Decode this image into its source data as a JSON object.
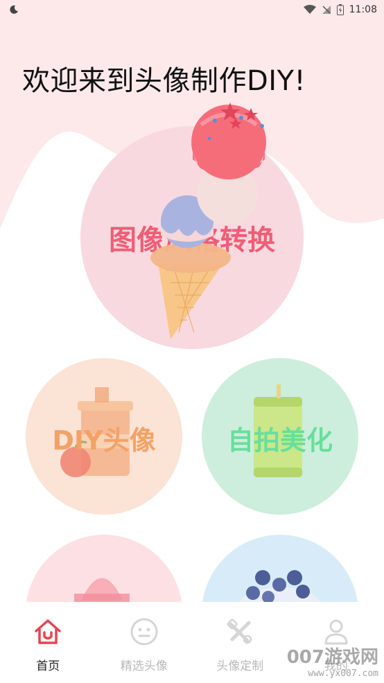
{
  "status_bar": {
    "time": "11:08"
  },
  "welcome": "欢迎来到头像制作DIY!",
  "cards": {
    "style_transfer": "图像风格转换",
    "diy_avatar": "DIY头像",
    "selfie_beauty": "自拍美化"
  },
  "tabs": [
    {
      "label": "首页",
      "icon": "home-icon",
      "active": true
    },
    {
      "label": "精选头像",
      "icon": "smiley-icon",
      "active": false
    },
    {
      "label": "头像定制",
      "icon": "tools-icon",
      "active": false
    },
    {
      "label": "我的",
      "icon": "person-icon",
      "active": false
    }
  ],
  "watermark": {
    "title": "007游戏网",
    "url": "www.yx007.com"
  },
  "colors": {
    "accent": "#e8444e",
    "style_text": "#f0506a",
    "diy_text": "#f3a266",
    "selfie_text": "#67df9c",
    "background_blob": "#fde8ea"
  }
}
